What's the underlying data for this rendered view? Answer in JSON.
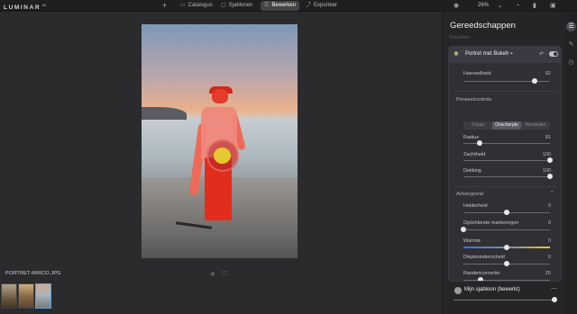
{
  "app": {
    "logo": "LUMINAR",
    "version": "AI"
  },
  "topbar": {
    "add_icon": "plus",
    "tabs": [
      {
        "label": "Catalogus",
        "icon": "catalog-icon"
      },
      {
        "label": "Sjablonen",
        "icon": "templates-icon"
      },
      {
        "label": "Bewerken",
        "icon": "edit-icon",
        "active": true
      },
      {
        "label": "Exporteer",
        "icon": "export-icon"
      }
    ],
    "zoom": "26%"
  },
  "viewer": {
    "filename": "PORTRET-MIRCO.JPG"
  },
  "panel": {
    "title": "Gereedschappen",
    "subtitle": "Favorites",
    "tool": {
      "name": "Portret met Bokeh",
      "amount": {
        "label": "Hoeveelheid",
        "value": 82
      },
      "brush_section": "Penseelcontrole",
      "brush_modes": [
        "Focus",
        "Onscherpte",
        "Herstellen"
      ],
      "brush_active": "Onscherpte",
      "brush_sliders": [
        {
          "label": "Radius",
          "value": 81,
          "fraction": 0.19
        },
        {
          "label": "Zachtheid",
          "value": 100,
          "fraction": 1.0
        },
        {
          "label": "Dekking",
          "value": 100,
          "fraction": 1.0
        }
      ],
      "background_section": "Achtergrond",
      "background_sliders": [
        {
          "label": "Helderheid",
          "value": 0,
          "fraction": 0.5
        },
        {
          "label": "Oplichtende markeringen",
          "value": 0,
          "fraction": 0.0
        },
        {
          "label": "Warmte",
          "value": 0,
          "fraction": 0.5
        },
        {
          "label": "Diepteonderscheid",
          "value": 0,
          "fraction": 0.5
        },
        {
          "label": "Randencorrectie",
          "value": 20,
          "fraction": 0.2
        }
      ]
    },
    "preset": {
      "name": "Mijn sjabloon (bewerkt)"
    }
  }
}
